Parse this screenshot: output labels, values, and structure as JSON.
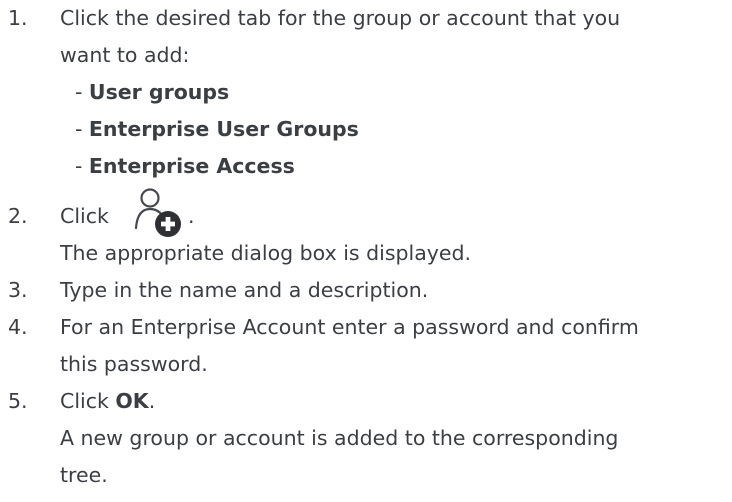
{
  "steps": [
    {
      "number": "1.",
      "lines": [
        "Click the desired tab for the group or account that you",
        "want to add:"
      ],
      "options": [
        "User groups",
        "Enterprise User Groups",
        "Enterprise Access"
      ]
    },
    {
      "number": "2.",
      "click_text": "Click",
      "after_icon": ".",
      "icon": "add-user-icon",
      "result": "The appropriate dialog box is displayed."
    },
    {
      "number": "3.",
      "text": "Type in the name and a description."
    },
    {
      "number": "4.",
      "lines": [
        "For an Enterprise Account enter a password and confirm",
        "this password."
      ]
    },
    {
      "number": "5.",
      "click_text": "Click ",
      "bold": "OK",
      "after_bold": ".",
      "result_lines": [
        "A new group or account is added to the corresponding",
        "tree."
      ]
    }
  ]
}
